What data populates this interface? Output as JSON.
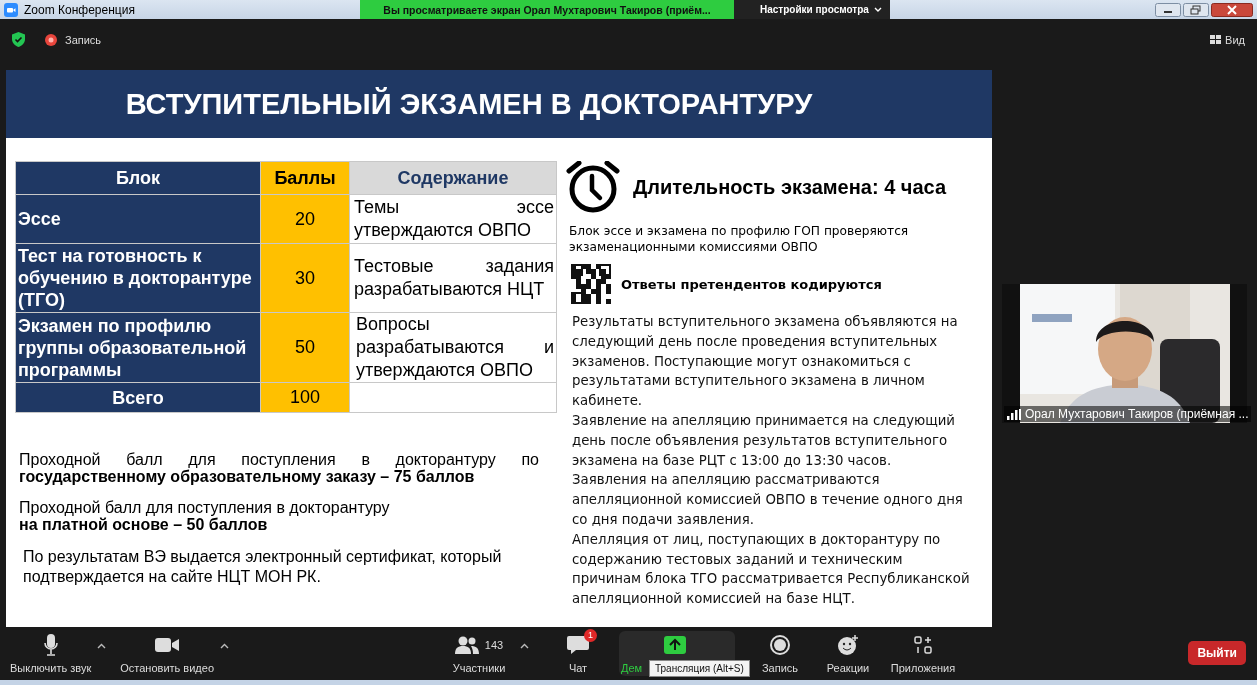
{
  "title_bar": {
    "title": "Zoom Конференция",
    "share_banner": "Вы просматриваете экран Орал Мухтарович Такиров (приём...",
    "view_options": "Настройки просмотра"
  },
  "top_bar": {
    "record_label": "Запись",
    "view_label": "Вид"
  },
  "slide": {
    "title": "ВСТУПИТЕЛЬНЫЙ ЭКЗАМЕН В ДОКТОРАНТУРУ",
    "table": {
      "columns": [
        "Блок",
        "Баллы",
        "Содержание"
      ],
      "rows": [
        {
          "cells": [
            "Эссе",
            "20",
            "Темы эссе утверждаются ОВПО"
          ]
        },
        {
          "cells": [
            "Тест на готовность к обучению в докторантуре (ТГО)",
            "30",
            "Тестовые задания разрабатываются НЦТ"
          ]
        },
        {
          "cells": [
            "Экзамен по профилю группы образовательной программы",
            "50",
            "Вопросы разрабатываются и утверждаются ОВПО"
          ]
        },
        {
          "cells": [
            "Всего",
            "100",
            ""
          ],
          "kind": "total"
        }
      ]
    },
    "passing_notes": [
      "Проходной балл для поступления в докторантуру по **государственному образовательному заказу – 75 баллов**",
      "Проходной балл для поступления в докторантуру\n**на платной основе – 50 баллов**",
      "По результатам ВЭ выдается электронный сертификат, который подтверждается на сайте НЦТ МОН РК."
    ],
    "duration": "Длительность экзамена: 4 часа",
    "checking_note": "Блок  эссе и экзамена по профилю ГОП  проверяются экзаменационными комиссиями ОВПО",
    "coding_note": "Ответы претендентов кодируются",
    "paragraphs": [
      "Результаты вступительного экзамена объявляются на следующий день после проведения вступительных экзаменов. Поступающие могут ознакомиться с результатами вступительного экзамена в личном кабинете.",
      "Заявление на апелляцию принимается на следующий день после объявления результатов вступительного экзамена на базе РЦТ с 13:00 до 13:30 часов.",
      "Заявления на апелляцию рассматриваются апелляционной комиссией ОВПО в течение одного дня со дня подачи заявления.",
      "Апелляция от лиц, поступающих в докторантуру по содержанию тестовых заданий и техническим причинам блока ТГО рассматривается Республиканской апелляционной комиссией на базе НЦТ."
    ]
  },
  "video": {
    "kind": "picture",
    "name": "Орал Мухтарович Такиров (приёмная ..."
  },
  "toolbar": {
    "buttons": [
      {
        "kind": "mic",
        "label": "Выключить звук",
        "caret": true,
        "selected": false
      },
      {
        "kind": "camera",
        "label": "Остановить видео",
        "caret": true,
        "selected": false
      },
      {
        "kind": "people",
        "label": "Участники",
        "count": "143",
        "caret": true,
        "selected": false
      },
      {
        "kind": "chat",
        "label": "Чат",
        "badge": "1",
        "caret": false,
        "selected": false
      },
      {
        "kind": "share",
        "label": "Дем",
        "caret": false,
        "selected": true
      },
      {
        "kind": "record",
        "label": "Запись",
        "caret": false,
        "selected": false
      },
      {
        "kind": "reactions",
        "label": "Реакции",
        "caret": false,
        "selected": false
      },
      {
        "kind": "apps",
        "label": "Приложения",
        "caret": false,
        "selected": false
      }
    ],
    "tooltip": "Трансляция (Alt+S)",
    "leave": "Выйти"
  }
}
